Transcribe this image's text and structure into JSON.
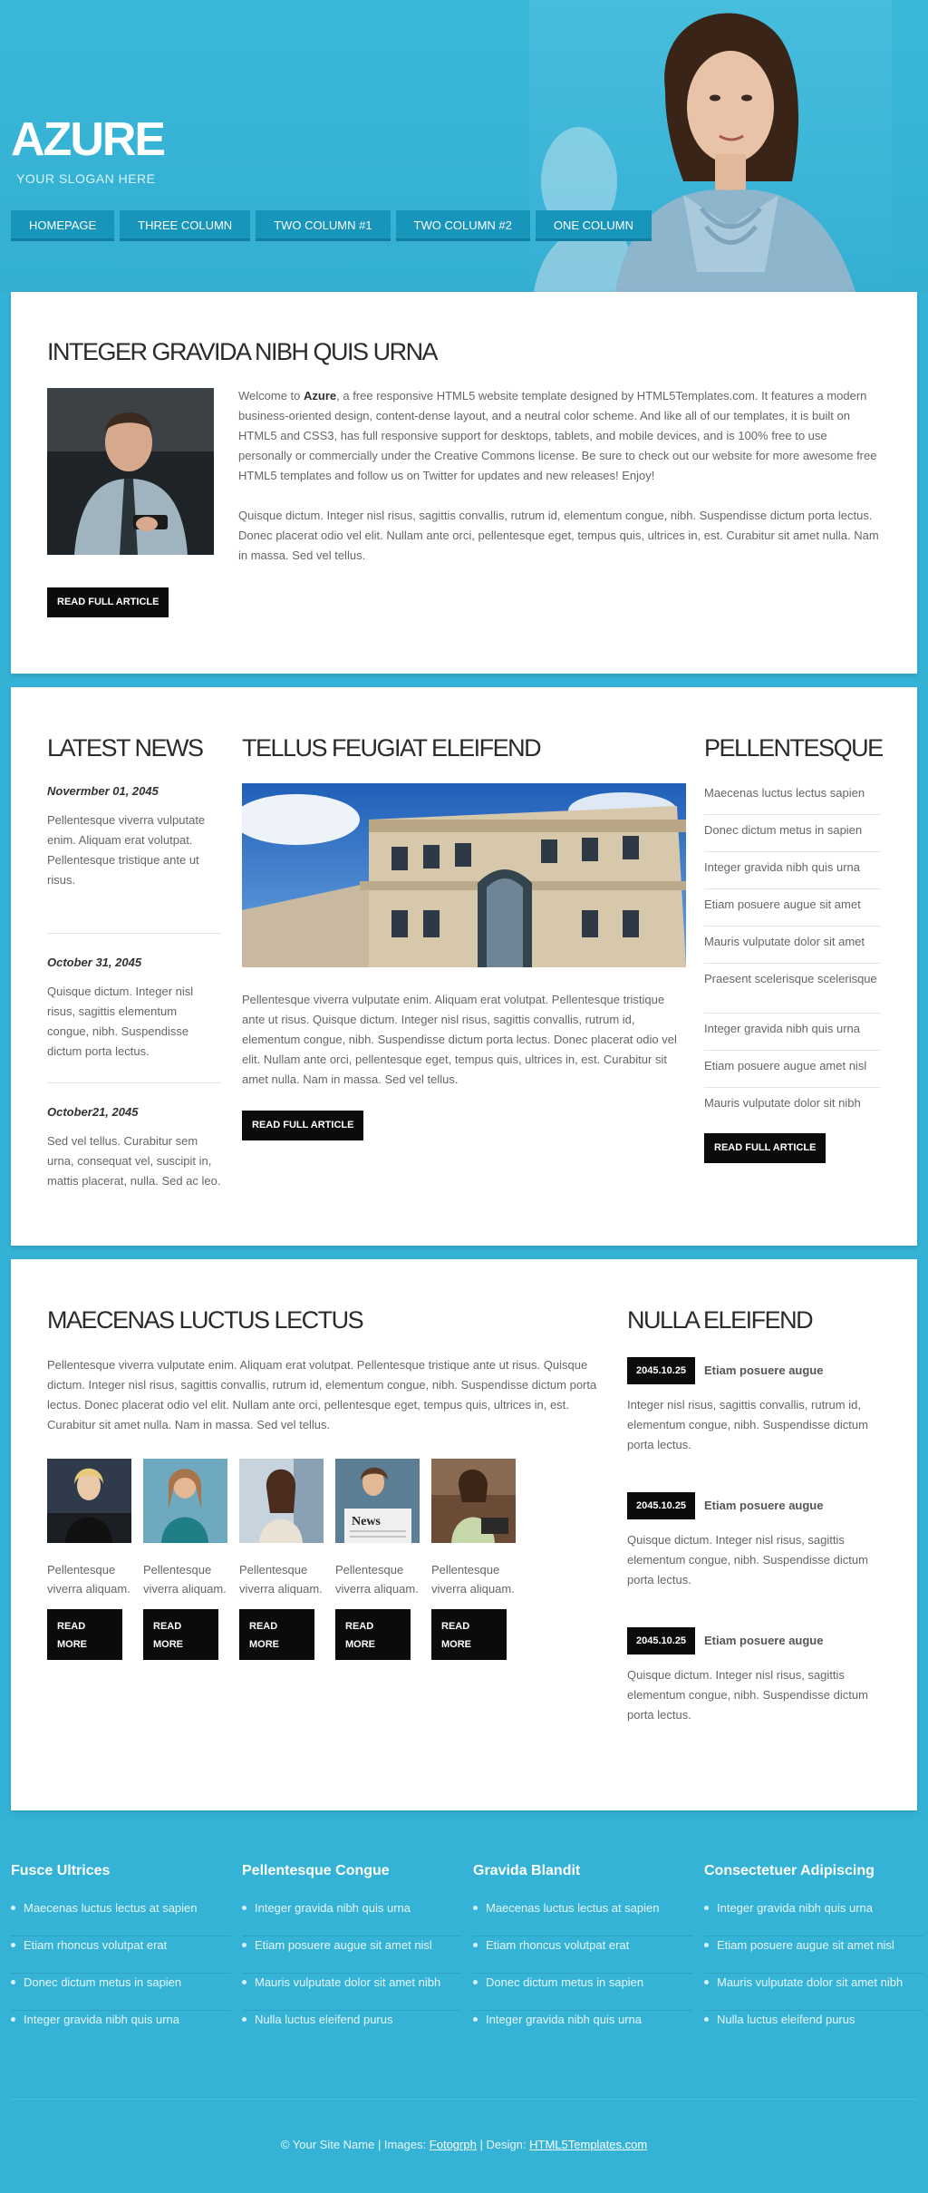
{
  "site": {
    "logo": "AZURE",
    "slogan": "YOUR SLOGAN HERE"
  },
  "nav": [
    "HOMEPAGE",
    "THREE COLUMN",
    "TWO COLUMN #1",
    "TWO COLUMN #2",
    "ONE COLUMN"
  ],
  "intro": {
    "title": "INTEGER GRAVIDA NIBH QUIS URNA",
    "p1_pre": "Welcome to ",
    "p1_bold": "Azure",
    "p1_post": ", a free responsive HTML5 website template designed by HTML5Templates.com. It features a modern business-oriented design, content-dense layout, and a neutral color scheme. And like all of our templates, it is built on HTML5 and CSS3, has full responsive support for desktops, tablets, and mobile devices, and is 100% free to use personally or commercially under the Creative Commons license. Be sure to check out our website for more awesome free HTML5 templates and follow us on Twitter for updates and new releases! Enjoy!",
    "p2": "Quisque dictum. Integer nisl risus, sagittis convallis, rutrum id, elementum congue, nibh. Suspendisse dictum porta lectus. Donec placerat odio vel elit. Nullam ante orci, pellentesque eget, tempus quis, ultrices in, est. Curabitur sit amet nulla. Nam in massa. Sed vel tellus.",
    "button": "READ FULL ARTICLE"
  },
  "news": {
    "title": "LATEST NEWS",
    "items": [
      {
        "date": "Novermber 01, 2045",
        "text": "Pellentesque viverra vulputate enim. Aliquam erat volutpat. Pellentesque tristique ante ut risus."
      },
      {
        "date": "October 31, 2045",
        "text": "Quisque dictum. Integer nisl risus, sagittis elementum congue, nibh. Suspendisse dictum porta lectus."
      },
      {
        "date": "October21, 2045",
        "text": "Sed vel tellus. Curabitur sem urna, consequat vel, suscipit in, mattis placerat, nulla. Sed ac leo."
      }
    ]
  },
  "feature": {
    "title": "TELLUS FEUGIAT ELEIFEND",
    "text": "Pellentesque viverra vulputate enim. Aliquam erat volutpat. Pellentesque tristique ante ut risus. Quisque dictum. Integer nisl risus, sagittis convallis, rutrum id, elementum congue, nibh. Suspendisse dictum porta lectus. Donec placerat odio vel elit. Nullam ante orci, pellentesque eget, tempus quis, ultrices in, est. Curabitur sit amet nulla. Nam in massa. Sed vel tellus.",
    "button": "READ FULL ARTICLE"
  },
  "pellentesque": {
    "title": "PELLENTESQUE",
    "items": [
      "Maecenas luctus lectus sapien",
      "Donec dictum metus in sapien",
      "Integer gravida nibh quis urna",
      "Etiam posuere augue sit amet",
      "Mauris vulputate dolor sit amet",
      "Praesent scelerisque scelerisque",
      "Integer gravida nibh quis urna",
      "Etiam posuere augue amet nisl",
      "Mauris vulputate dolor sit nibh"
    ],
    "button": "READ FULL ARTICLE"
  },
  "maecenas": {
    "title": "MAECENAS LUCTUS LECTUS",
    "text": "Pellentesque viverra vulputate enim. Aliquam erat volutpat. Pellentesque tristique ante ut risus. Quisque dictum. Integer nisl risus, sagittis convallis, rutrum id, elementum congue, nibh. Suspendisse dictum porta lectus. Donec placerat odio vel elit. Nullam ante orci, pellentesque eget, tempus quis, ultrices in, est. Curabitur sit amet nulla. Nam in massa. Sed vel tellus.",
    "thumb_text": "Pellentesque viverra aliquam.",
    "thumb_button": "READ MORE",
    "news_word": "News"
  },
  "nulla": {
    "title": "NULLA ELEIFEND",
    "items": [
      {
        "date": "2045.10.25",
        "title": "Etiam posuere augue",
        "text": "Integer nisl risus, sagittis convallis, rutrum id, elementum congue, nibh. Suspendisse dictum porta lectus."
      },
      {
        "date": "2045.10.25",
        "title": "Etiam posuere augue",
        "text": "Quisque dictum. Integer nisl risus, sagittis elementum congue, nibh. Suspendisse dictum porta lectus."
      },
      {
        "date": "2045.10.25",
        "title": "Etiam posuere augue",
        "text": "Quisque dictum. Integer nisl risus, sagittis elementum congue, nibh. Suspendisse dictum porta lectus."
      }
    ]
  },
  "footer": {
    "columns": [
      {
        "title": "Fusce Ultrices",
        "items": [
          "Maecenas luctus lectus at sapien",
          "Etiam rhoncus volutpat erat",
          "Donec dictum metus in sapien",
          "Integer gravida nibh quis urna"
        ]
      },
      {
        "title": "Pellentesque Congue",
        "items": [
          "Integer gravida nibh quis urna",
          "Etiam posuere augue sit amet nisl",
          "Mauris vulputate dolor sit amet nibh",
          "Nulla luctus eleifend purus"
        ]
      },
      {
        "title": "Gravida Blandit",
        "items": [
          "Maecenas luctus lectus at sapien",
          "Etiam rhoncus volutpat erat",
          "Donec dictum metus in sapien",
          "Integer gravida nibh quis urna"
        ]
      },
      {
        "title": "Consectetuer Adipiscing",
        "items": [
          "Integer gravida nibh quis urna",
          "Etiam posuere augue sit amet nisl",
          "Mauris vulputate dolor sit amet nibh",
          "Nulla luctus eleifend purus"
        ]
      }
    ],
    "copyright_pre": "© Your Site Name | Images: ",
    "images_link": "Fotogrph",
    "design_sep": " | Design: ",
    "design_link": "HTML5Templates.com"
  }
}
